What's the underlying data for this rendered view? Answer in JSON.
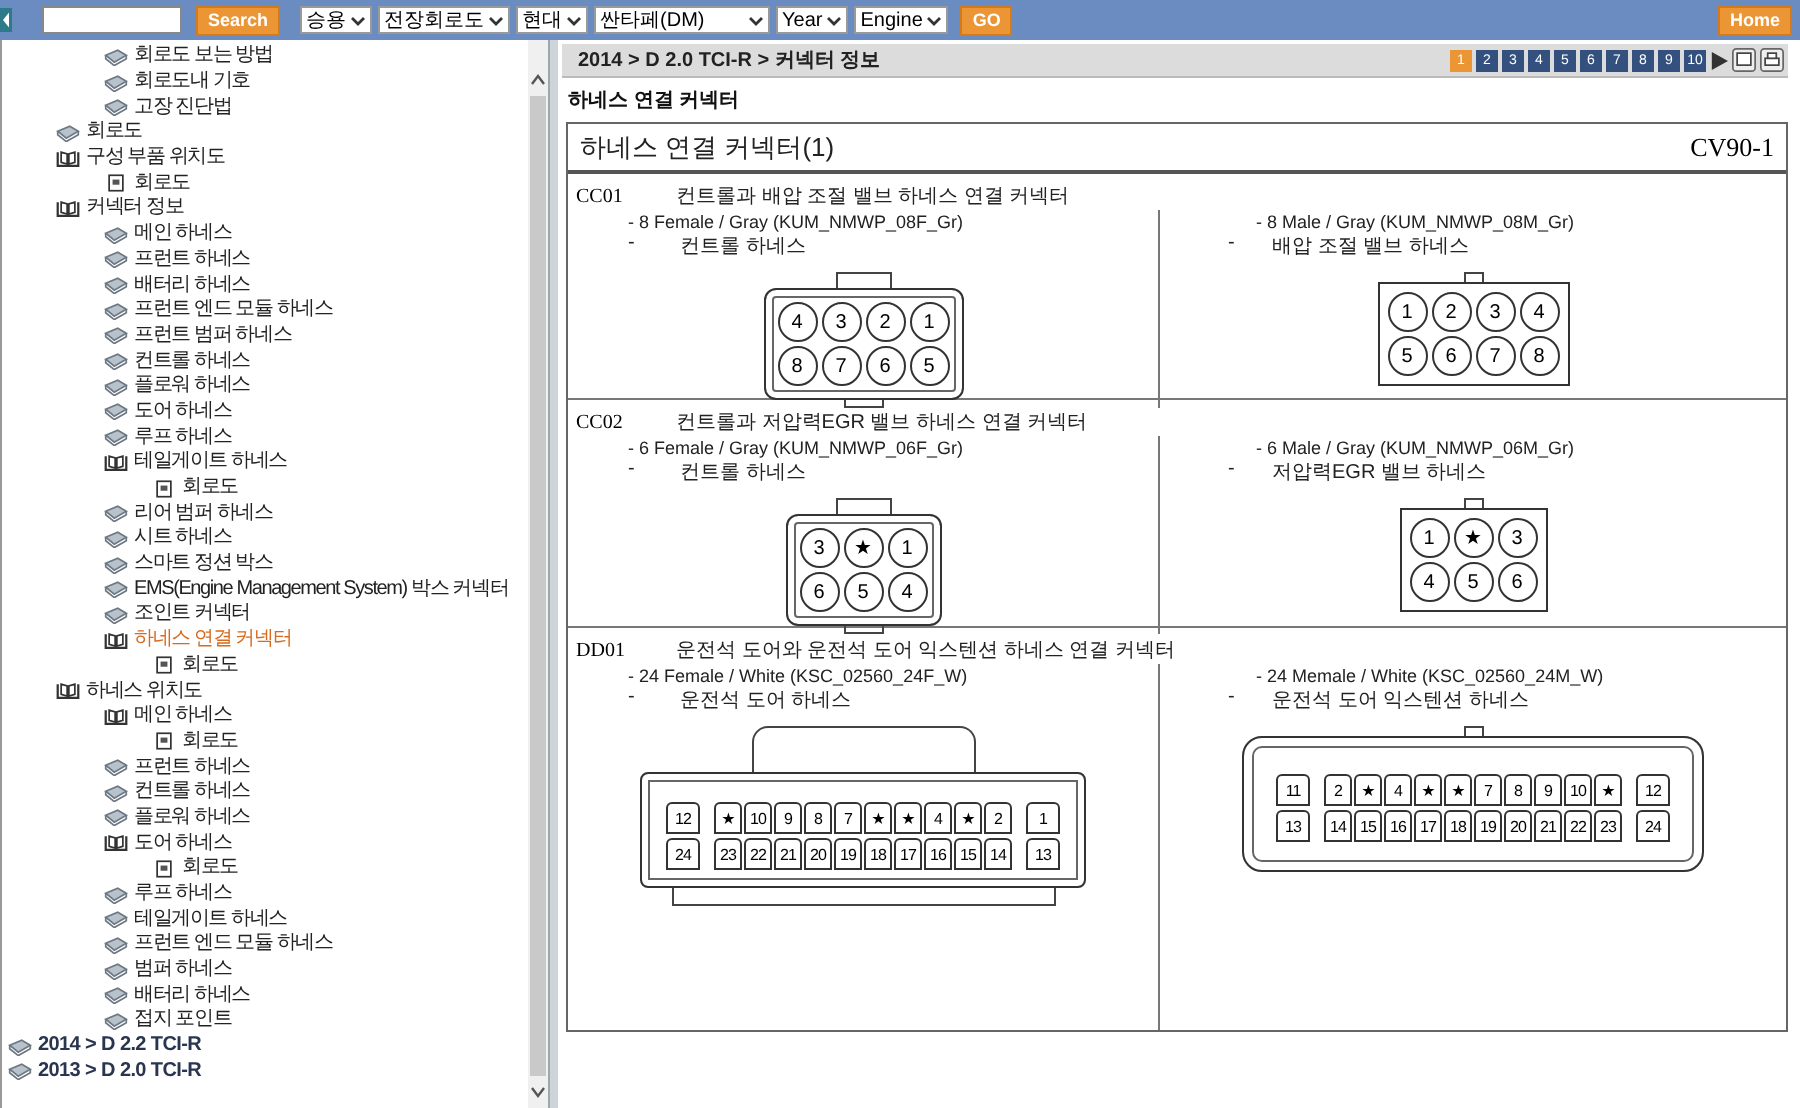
{
  "toolbar": {
    "search_button": "Search",
    "dropdowns": [
      {
        "value": "승용"
      },
      {
        "value": "전장회로도"
      },
      {
        "value": "현대"
      },
      {
        "value": "싼타페(DM)"
      },
      {
        "value": "Year"
      },
      {
        "value": "Engine"
      }
    ],
    "go_button": "GO",
    "home_button": "Home"
  },
  "sidebar": {
    "tree": [
      {
        "children": [
          {
            "children": [
              {
                "label": "회로도 보는 방법",
                "kind": "book",
                "selected": false
              },
              {
                "label": "회로도내 기호",
                "kind": "book",
                "selected": false
              },
              {
                "label": "고장 진단법",
                "kind": "book",
                "selected": false
              }
            ]
          },
          {
            "label": "회로도",
            "kind": "book",
            "selected": false
          },
          {
            "label": "구성 부품 위치도",
            "kind": "open",
            "selected": false,
            "children": [
              {
                "label": "회로도",
                "kind": "page",
                "selected": false
              }
            ]
          },
          {
            "label": "커넥터 정보",
            "kind": "open",
            "selected": false,
            "children": [
              {
                "label": "메인 하네스",
                "kind": "book",
                "selected": false
              },
              {
                "label": "프런트 하네스",
                "kind": "book",
                "selected": false
              },
              {
                "label": "배터리 하네스",
                "kind": "book",
                "selected": false
              },
              {
                "label": "프런트 엔드 모듈 하네스",
                "kind": "book",
                "selected": false
              },
              {
                "label": "프런트 범퍼 하네스",
                "kind": "book",
                "selected": false
              },
              {
                "label": "컨트롤 하네스",
                "kind": "book",
                "selected": false
              },
              {
                "label": "플로워 하네스",
                "kind": "book",
                "selected": false
              },
              {
                "label": "도어 하네스",
                "kind": "book",
                "selected": false
              },
              {
                "label": "루프 하네스",
                "kind": "book",
                "selected": false
              },
              {
                "label": "테일게이트 하네스",
                "kind": "open",
                "selected": false,
                "children": [
                  {
                    "label": "회로도",
                    "kind": "page",
                    "selected": false
                  }
                ]
              },
              {
                "label": "리어 범퍼 하네스",
                "kind": "book",
                "selected": false
              },
              {
                "label": "시트 하네스",
                "kind": "book",
                "selected": false
              },
              {
                "label": "스마트 정션 박스",
                "kind": "book",
                "selected": false
              },
              {
                "label": "EMS(Engine Management System) 박스 커넥터",
                "kind": "book",
                "selected": false
              },
              {
                "label": "조인트 커넥터",
                "kind": "book",
                "selected": false
              },
              {
                "label": "하네스 연결 커넥터",
                "kind": "open",
                "selected": true,
                "children": [
                  {
                    "label": "회로도",
                    "kind": "page",
                    "selected": false
                  }
                ]
              }
            ]
          },
          {
            "label": "하네스 위치도",
            "kind": "open",
            "selected": false,
            "children": [
              {
                "label": "메인 하네스",
                "kind": "open",
                "selected": false,
                "children": [
                  {
                    "label": "회로도",
                    "kind": "page",
                    "selected": false
                  }
                ]
              },
              {
                "label": "프런트 하네스",
                "kind": "book",
                "selected": false
              },
              {
                "label": "컨트롤 하네스",
                "kind": "book",
                "selected": false
              },
              {
                "label": "플로워 하네스",
                "kind": "book",
                "selected": false
              },
              {
                "label": "도어 하네스",
                "kind": "open",
                "selected": false,
                "children": [
                  {
                    "label": "회로도",
                    "kind": "page",
                    "selected": false
                  }
                ]
              },
              {
                "label": "루프 하네스",
                "kind": "book",
                "selected": false
              },
              {
                "label": "테일게이트 하네스",
                "kind": "book",
                "selected": false
              },
              {
                "label": "프런트 엔드 모듈 하네스",
                "kind": "book",
                "selected": false
              },
              {
                "label": "범퍼 하네스",
                "kind": "book",
                "selected": false
              },
              {
                "label": "배터리 하네스",
                "kind": "book",
                "selected": false
              },
              {
                "label": "접지 포인트",
                "kind": "book",
                "selected": false
              }
            ]
          }
        ]
      },
      {
        "label": "2014 > D 2.2 TCI-R",
        "kind": "book",
        "selected": false
      },
      {
        "label": "2013 > D 2.0 TCI-R",
        "kind": "book",
        "selected": false
      }
    ]
  },
  "content": {
    "breadcrumb": "2014 > D 2.0 TCI-R > 커넥터 정보",
    "pages": [
      {
        "label": "1",
        "selected": true
      },
      {
        "label": "2",
        "selected": false
      },
      {
        "label": "3",
        "selected": false
      },
      {
        "label": "4",
        "selected": false
      },
      {
        "label": "5",
        "selected": false
      },
      {
        "label": "6",
        "selected": false
      },
      {
        "label": "7",
        "selected": false
      },
      {
        "label": "8",
        "selected": false
      },
      {
        "label": "9",
        "selected": false
      },
      {
        "label": "10",
        "selected": false
      }
    ],
    "heading": "하네스 연결 커넥터",
    "document": {
      "title": "하네스 연결 커넥터(1)",
      "code": "CV90-1",
      "sections": [
        {
          "code": "CC01",
          "title": "컨트롤과 배압 조절 밸브 하네스 연결 커넥터",
          "connectors": [
            {
              "spec": "- 8 Female / Gray (KUM_NMWP_08F_Gr)",
              "dash": "-",
              "harness": "컨트롤 하네스",
              "kind": "female",
              "rows": [
                [
                  "4",
                  "3",
                  "2",
                  "1"
                ],
                [
                  "8",
                  "7",
                  "6",
                  "5"
                ]
              ]
            },
            {
              "spec": "- 8 Male / Gray (KUM_NMWP_08M_Gr)",
              "dash": "-",
              "harness": "배압 조절 밸브 하네스",
              "kind": "male",
              "rows": [
                [
                  "1",
                  "2",
                  "3",
                  "4"
                ],
                [
                  "5",
                  "6",
                  "7",
                  "8"
                ]
              ]
            }
          ]
        },
        {
          "code": "CC02",
          "title": "컨트롤과 저압력EGR 밸브 하네스 연결 커넥터",
          "connectors": [
            {
              "spec": "- 6 Female / Gray (KUM_NMWP_06F_Gr)",
              "dash": "-",
              "harness": "컨트롤 하네스",
              "kind": "female",
              "rows": [
                [
                  "3",
                  "★",
                  "1"
                ],
                [
                  "6",
                  "5",
                  "4"
                ]
              ]
            },
            {
              "spec": "- 6 Male / Gray (KUM_NMWP_06M_Gr)",
              "dash": "-",
              "harness": "저압력EGR 밸브 하네스",
              "kind": "male",
              "rows": [
                [
                  "1",
                  "★",
                  "3"
                ],
                [
                  "4",
                  "5",
                  "6"
                ]
              ]
            }
          ]
        },
        {
          "code": "DD01",
          "title": "운전석 도어와 운전석 도어 익스텐션 하네스 연결 커넥터",
          "connectors": [
            {
              "spec": "- 24 Female / White (KSC_02560_24F_W)",
              "dash": "-",
              "harness": "운전석 도어 하네스",
              "kind": "female-wide",
              "rows": [
                [
                  "12",
                  "★",
                  "10",
                  "9",
                  "8",
                  "7",
                  "★",
                  "★",
                  "4",
                  "★",
                  "2",
                  "1"
                ],
                [
                  "24",
                  "23",
                  "22",
                  "21",
                  "20",
                  "19",
                  "18",
                  "17",
                  "16",
                  "15",
                  "14",
                  "13"
                ]
              ]
            },
            {
              "spec": "- 24 Memale / White (KSC_02560_24M_W)",
              "dash": "-",
              "harness": "운전석 도어 익스텐션 하네스",
              "kind": "male-wide",
              "rows": [
                [
                  "11",
                  "2",
                  "★",
                  "4",
                  "★",
                  "★",
                  "7",
                  "8",
                  "9",
                  "10",
                  "★",
                  "12"
                ],
                [
                  "13",
                  "14",
                  "15",
                  "16",
                  "17",
                  "18",
                  "19",
                  "20",
                  "21",
                  "22",
                  "23",
                  "24"
                ]
              ]
            }
          ]
        }
      ]
    }
  }
}
